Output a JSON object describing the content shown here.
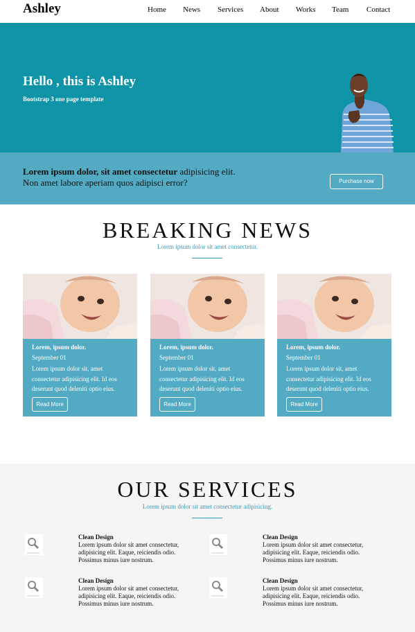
{
  "nav": {
    "brand": "Ashley",
    "items": [
      "Home",
      "News",
      "Services",
      "About",
      "Works",
      "Team",
      "Contact"
    ]
  },
  "hero": {
    "title": "Hello , this is Ashley",
    "subtitle": "Bootstrap 3 one page template"
  },
  "callout": {
    "bold": "Lorem ipsum dolor, sit amet consectetur",
    "rest": " adipisicing elit.",
    "line2": "Non amet labore aperiam quos adipisci error?",
    "button": "Purchase now"
  },
  "news": {
    "title": "BREAKING NEWS",
    "subtitle": "Lorem ipsum dolor sit amet consectetur.",
    "cards": [
      {
        "title": "Lorem, ipsum dolor.",
        "date": "September 01",
        "body": "Lorem ipsum dolor sit, amet consectetur adipisicing elit. Id eos deserunt quod deleniti optio eius.",
        "button": "Read More"
      },
      {
        "title": "Lorem, ipsum dolor.",
        "date": "September 01",
        "body": "Lorem ipsum dolor sit, amet consectetur adipisicing elit. Id eos deserunt quod deleniti optio eius.",
        "button": "Read More"
      },
      {
        "title": "Lorem, ipsum dolor.",
        "date": "September 01",
        "body": "Lorem ipsum dolor sit, amet consectetur adipisicing elit. Id eos deserunt quod deleniti optio eius.",
        "button": "Read More"
      }
    ]
  },
  "services": {
    "title": "OUR SERVICES",
    "subtitle": "Lorem ipsum dolor sit amet consectetur adipisicing.",
    "items": [
      {
        "title": "Clean Design",
        "body": "Lorem ipsum dolor sit amet consectetur, adipisicing elit. Eaque, reiciendis odio. Possimus minus iure nostrum."
      },
      {
        "title": "Clean Design",
        "body": "Lorem ipsum dolor sit amet consectetur, adipisicing elit. Eaque, reiciendis odio. Possimus minus iure nostrum."
      },
      {
        "title": "Clean Design",
        "body": "Lorem ipsum dolor sit amet consectetur, adipisicing elit. Eaque, reiciendis odio. Possimus minus iure nostrum."
      },
      {
        "title": "Clean Design",
        "body": "Lorem ipsum dolor sit amet consectetur, adipisicing elit. Eaque, reiciendis odio. Possimus minus iure nostrum."
      }
    ],
    "icon": "magnifier-icon"
  },
  "colors": {
    "hero_bg": "#0f93a6",
    "callout_bg": "#53aac3",
    "card_bg": "#53aac3",
    "accent": "#3a9ab5",
    "services_bg": "#f5f5f5"
  }
}
